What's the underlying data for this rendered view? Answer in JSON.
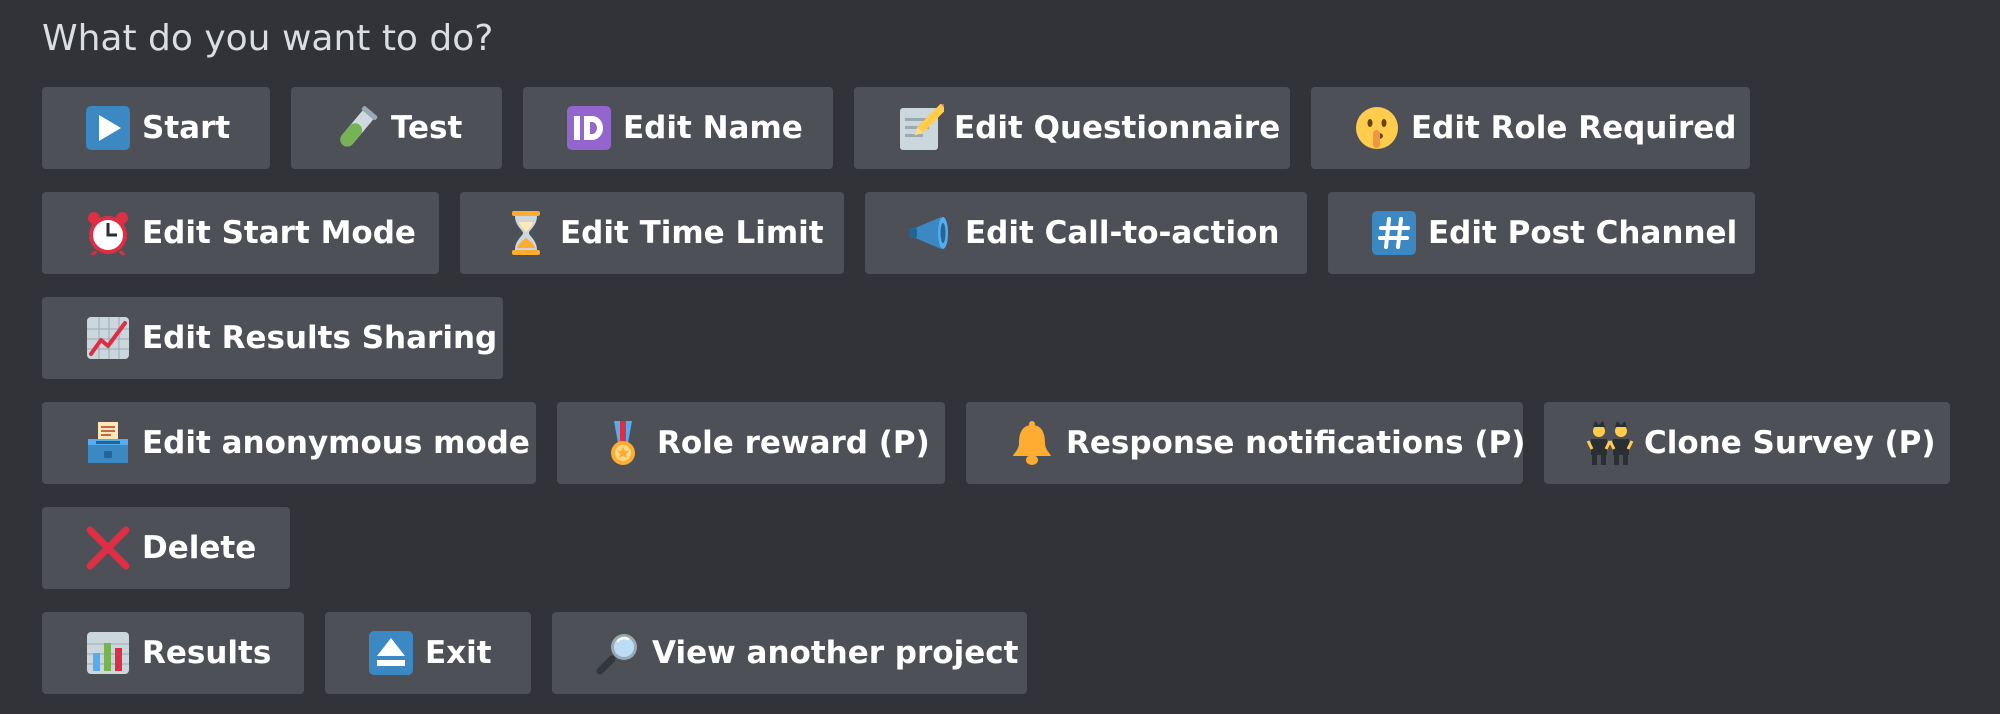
{
  "prompt": "What do you want to do?",
  "buttons": {
    "start": {
      "label": "Start",
      "icon": "play-button-icon"
    },
    "test": {
      "label": "Test",
      "icon": "test-tube-icon"
    },
    "edit_name": {
      "label": "Edit Name",
      "icon": "id-icon"
    },
    "edit_questionnaire": {
      "label": "Edit Questionnaire",
      "icon": "memo-icon"
    },
    "edit_role_required": {
      "label": "Edit Role Required",
      "icon": "shushing-face-icon"
    },
    "edit_start_mode": {
      "label": "Edit Start Mode",
      "icon": "alarm-clock-icon"
    },
    "edit_time_limit": {
      "label": "Edit Time Limit",
      "icon": "hourglass-icon"
    },
    "edit_call_to_action": {
      "label": "Edit Call-to-action",
      "icon": "megaphone-icon"
    },
    "edit_post_channel": {
      "label": "Edit Post Channel",
      "icon": "hash-icon"
    },
    "edit_results_sharing": {
      "label": "Edit Results Sharing",
      "icon": "chart-increasing-icon"
    },
    "edit_anonymous_mode": {
      "label": "Edit anonymous mode",
      "icon": "ballot-box-icon"
    },
    "role_reward": {
      "label": "Role reward (P)",
      "icon": "medal-icon"
    },
    "response_notifications": {
      "label": "Response notifications (P)",
      "icon": "bell-icon"
    },
    "clone_survey": {
      "label": "Clone Survey (P)",
      "icon": "twins-icon"
    },
    "delete": {
      "label": "Delete",
      "icon": "cross-mark-icon"
    },
    "results": {
      "label": "Results",
      "icon": "bar-chart-icon"
    },
    "exit": {
      "label": "Exit",
      "icon": "eject-icon"
    },
    "view_another_project": {
      "label": "View another project",
      "icon": "magnifying-glass-icon"
    }
  },
  "colors": {
    "background": "#313338",
    "button": "#4e5058",
    "button_text": "#ffffff",
    "prompt_text": "#dbdee1"
  }
}
